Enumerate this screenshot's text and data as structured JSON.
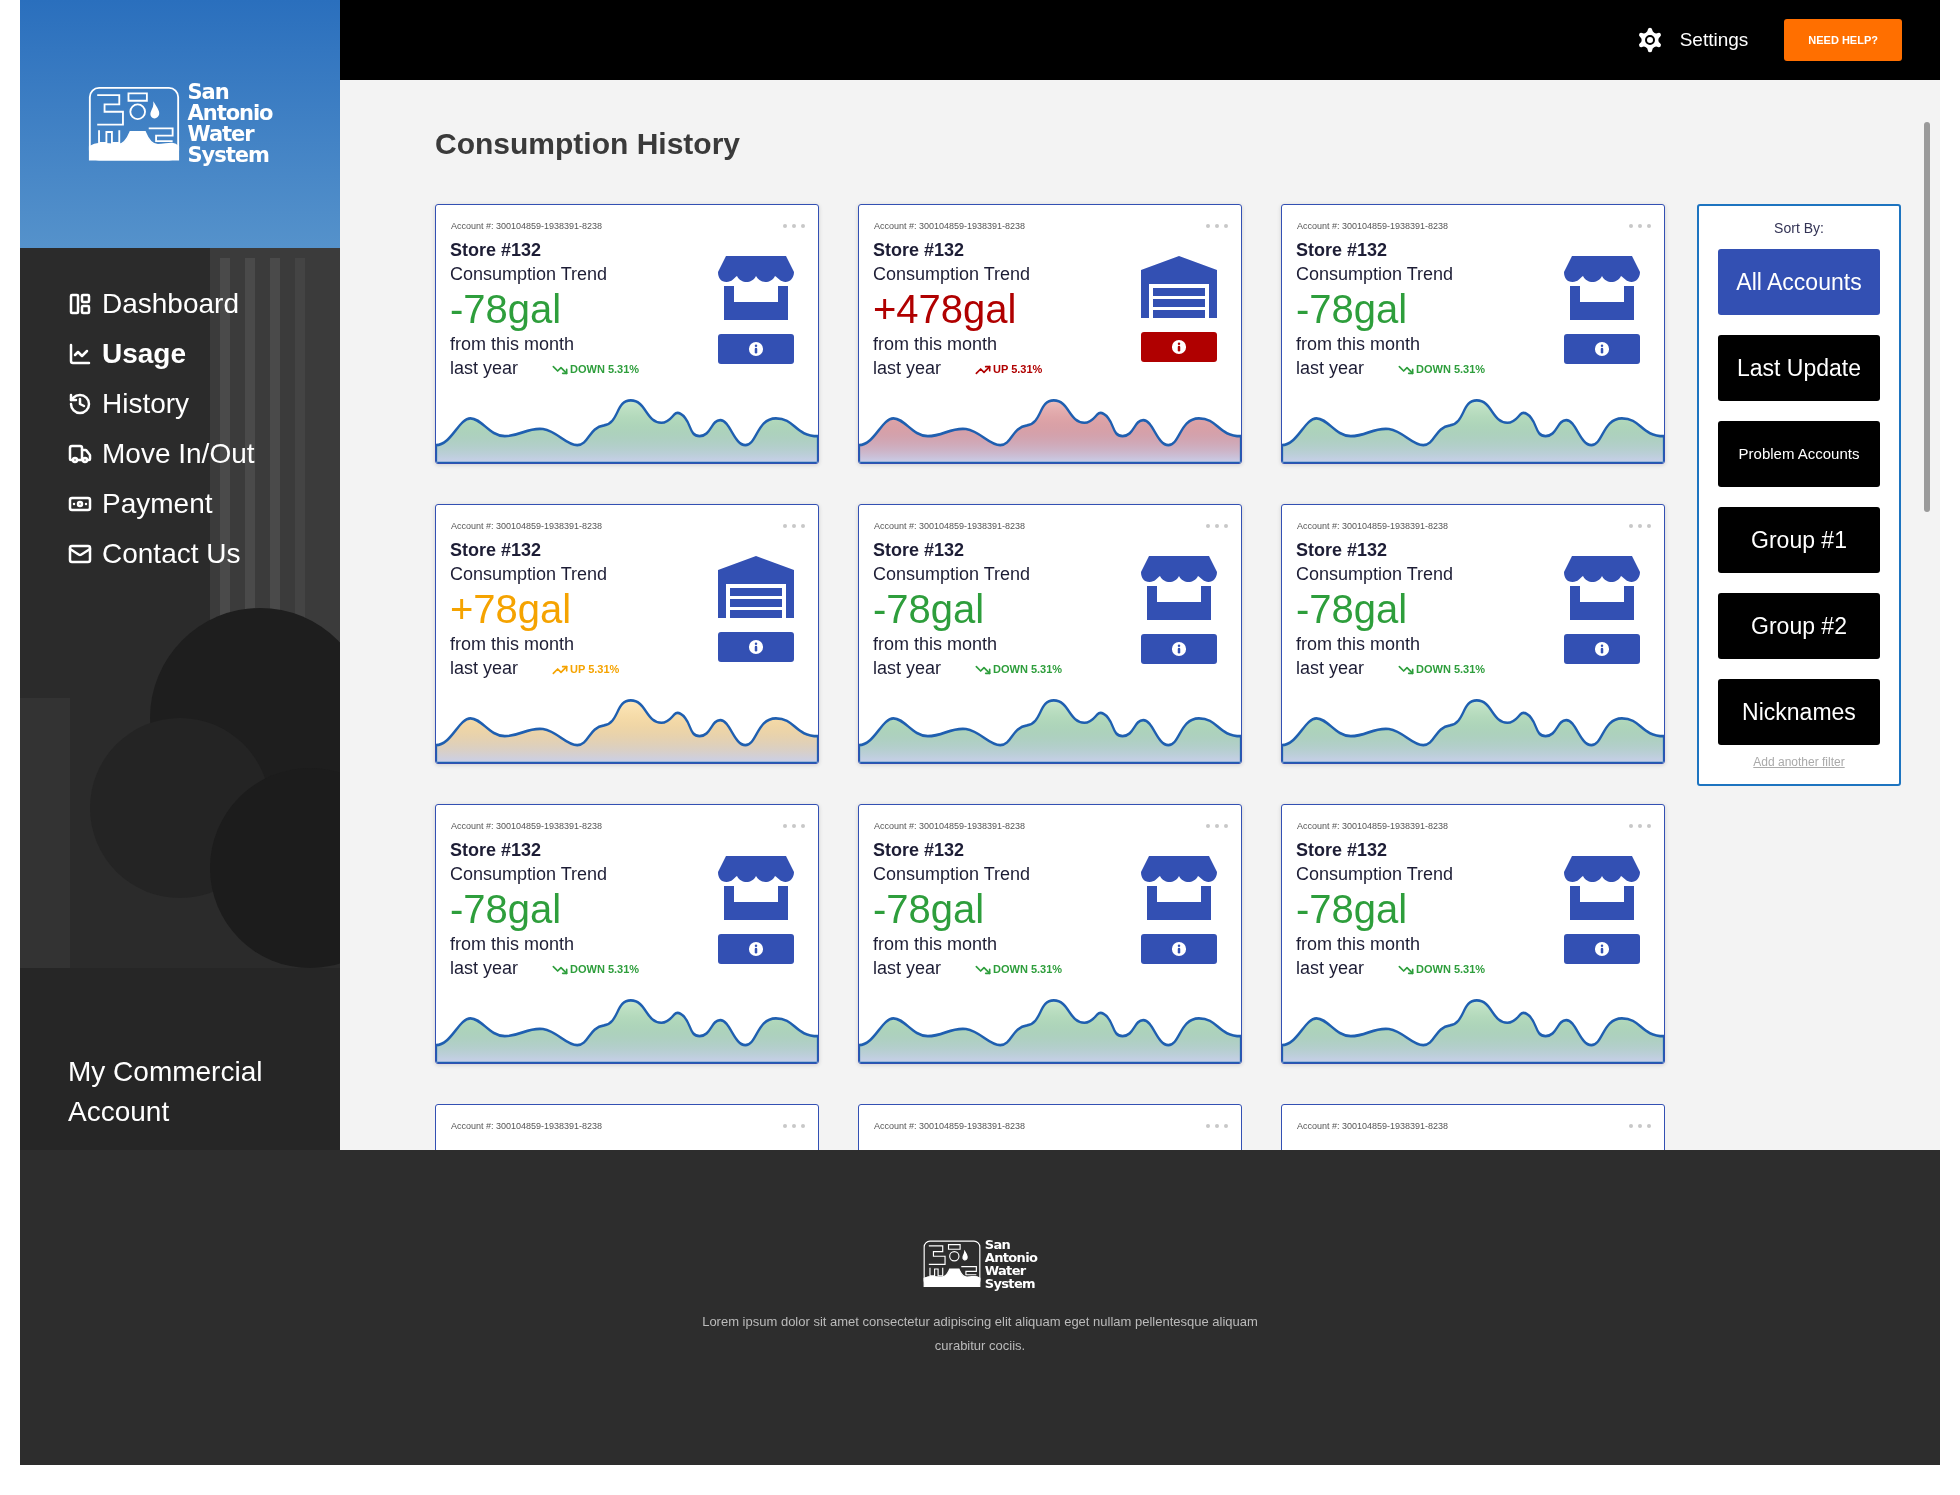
{
  "logo": {
    "lines": [
      "San",
      "Antonio",
      "Water",
      "System"
    ]
  },
  "nav": [
    {
      "label": "Dashboard",
      "selected": false
    },
    {
      "label": "Usage",
      "selected": true
    },
    {
      "label": "History",
      "selected": false
    },
    {
      "label": "Move In/Out",
      "selected": false
    },
    {
      "label": "Payment",
      "selected": false
    },
    {
      "label": "Contact Us",
      "selected": false
    }
  ],
  "account_label": "My Commercial Account",
  "topbar": {
    "settings": "Settings",
    "help": "NEED HELP?"
  },
  "title": "Consumption History",
  "cards": [
    {
      "kind": "store",
      "color": "#2e9e3c",
      "alert": false,
      "account": "Account #: 300104859-1938391-8238",
      "name": "Store #132",
      "subtitle": "Consumption Trend",
      "value": "-78gal",
      "line1": "from this month",
      "line2": "last year",
      "trend": {
        "kind": "down",
        "text": "DOWN 5.31%"
      }
    },
    {
      "kind": "warehouse",
      "color": "#b00000",
      "alert": true,
      "account": "Account #: 300104859-1938391-8238",
      "name": "Store #132",
      "subtitle": "Consumption Trend",
      "value": "+478gal",
      "line1": "from this month",
      "line2": "last year",
      "trend": {
        "kind": "up",
        "text": "UP 5.31%"
      }
    },
    {
      "kind": "store",
      "color": "#2e9e3c",
      "alert": false,
      "account": "Account #: 300104859-1938391-8238",
      "name": "Store #132",
      "subtitle": "Consumption Trend",
      "value": "-78gal",
      "line1": "from this month",
      "line2": "last year",
      "trend": {
        "kind": "down",
        "text": "DOWN 5.31%"
      }
    },
    {
      "kind": "warehouse",
      "color": "#f5a300",
      "alert": false,
      "account": "Account #: 300104859-1938391-8238",
      "name": "Store #132",
      "subtitle": "Consumption Trend",
      "value": "+78gal",
      "line1": "from this month",
      "line2": "last year",
      "trend": {
        "kind": "up",
        "text": "UP 5.31%"
      }
    },
    {
      "kind": "store",
      "color": "#2e9e3c",
      "alert": false,
      "account": "Account #: 300104859-1938391-8238",
      "name": "Store #132",
      "subtitle": "Consumption Trend",
      "value": "-78gal",
      "line1": "from this month",
      "line2": "last year",
      "trend": {
        "kind": "down",
        "text": "DOWN 5.31%"
      }
    },
    {
      "kind": "store",
      "color": "#2e9e3c",
      "alert": false,
      "account": "Account #: 300104859-1938391-8238",
      "name": "Store #132",
      "subtitle": "Consumption Trend",
      "value": "-78gal",
      "line1": "from this month",
      "line2": "last year",
      "trend": {
        "kind": "down",
        "text": "DOWN 5.31%"
      }
    },
    {
      "kind": "store",
      "color": "#2e9e3c",
      "alert": false,
      "account": "Account #: 300104859-1938391-8238",
      "name": "Store #132",
      "subtitle": "Consumption Trend",
      "value": "-78gal",
      "line1": "from this month",
      "line2": "last year",
      "trend": {
        "kind": "down",
        "text": "DOWN 5.31%"
      }
    },
    {
      "kind": "store",
      "color": "#2e9e3c",
      "alert": false,
      "account": "Account #: 300104859-1938391-8238",
      "name": "Store #132",
      "subtitle": "Consumption Trend",
      "value": "-78gal",
      "line1": "from this month",
      "line2": "last year",
      "trend": {
        "kind": "down",
        "text": "DOWN 5.31%"
      }
    },
    {
      "kind": "store",
      "color": "#2e9e3c",
      "alert": false,
      "account": "Account #: 300104859-1938391-8238",
      "name": "Store #132",
      "subtitle": "Consumption Trend",
      "value": "-78gal",
      "line1": "from this month",
      "line2": "last year",
      "trend": {
        "kind": "down",
        "text": "DOWN 5.31%"
      }
    }
  ],
  "partial_cards": [
    {
      "account": "Account #: 300104859-1938391-8238"
    },
    {
      "account": "Account #: 300104859-1938391-8238"
    },
    {
      "account": "Account #: 300104859-1938391-8238"
    }
  ],
  "sort": {
    "label": "Sort By:",
    "options": [
      {
        "label": "All Accounts",
        "selected": true,
        "kind": "large"
      },
      {
        "label": "Last Update",
        "selected": false,
        "kind": "large"
      },
      {
        "label": "Problem Accounts",
        "selected": false,
        "kind": "small"
      },
      {
        "label": "Group #1",
        "selected": false,
        "kind": "large"
      },
      {
        "label": "Group #2",
        "selected": false,
        "kind": "large"
      },
      {
        "label": "Nicknames",
        "selected": false,
        "kind": "large"
      }
    ],
    "add": "Add another filter"
  },
  "footer": {
    "logo": [
      "San",
      "Antonio",
      "Water",
      "System"
    ],
    "text": "Lorem ipsum dolor sit amet consectetur adipiscing elit aliquam eget nullam pellentesque aliquam curabitur cociis."
  }
}
